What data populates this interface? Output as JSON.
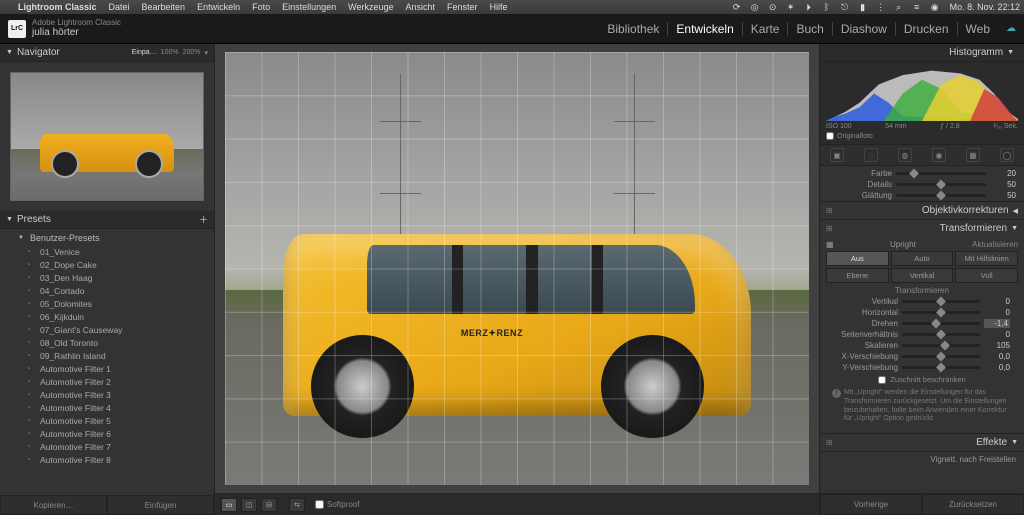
{
  "mac_menubar": {
    "app": "Lightroom Classic",
    "items": [
      "Datei",
      "Bearbeiten",
      "Entwickeln",
      "Foto",
      "Einstellungen",
      "Werkzeuge",
      "Ansicht",
      "Fenster",
      "Hilfe"
    ],
    "clock": "Mo. 8. Nov.  22:12"
  },
  "app_header": {
    "product": "Adobe Lightroom Classic",
    "catalog": "julia hörter",
    "modules": [
      "Bibliothek",
      "Entwickeln",
      "Karte",
      "Buch",
      "Diashow",
      "Drucken",
      "Web"
    ],
    "active_module": "Entwickeln"
  },
  "navigator": {
    "title": "Navigator",
    "zoom": [
      "Einpa…",
      "100%",
      "200%"
    ],
    "zoom_active": "Einpa…"
  },
  "presets": {
    "title": "Presets",
    "group": "Benutzer-Presets",
    "items": [
      "01_Venice",
      "02_Dope Cake",
      "03_Den Haag",
      "04_Cortado",
      "05_Dolomites",
      "06_Kijkduin",
      "07_Giant's Causeway",
      "08_Old Toronto",
      "09_Rathlin Island",
      "Automotive Filter 1",
      "Automotive Filter 2",
      "Automotive Filter 3",
      "Automotive Filter 4",
      "Automotive Filter 5",
      "Automotive Filter 6",
      "Automotive Filter 7",
      "Automotive Filter 8"
    ]
  },
  "left_bottom": {
    "copy": "Kopieren…",
    "paste": "Einfügen"
  },
  "toolbar": {
    "softproof": "Softproof"
  },
  "histogram": {
    "title": "Histogramm",
    "iso": "ISO 100",
    "focal": "54 mm",
    "aperture": "ƒ / 2,8",
    "shutter": "¹⁄₁₀ Sek.",
    "original": "Originalfoto"
  },
  "noise": {
    "farbe": {
      "label": "Farbe",
      "value": "20"
    },
    "details": {
      "label": "Details",
      "value": "50"
    },
    "glaettung": {
      "label": "Glättung",
      "value": "50"
    }
  },
  "lens": {
    "title": "Objektivkorrekturen"
  },
  "transform": {
    "title": "Transformieren",
    "upright_label": "Upright",
    "update": "Aktualisieren",
    "buttons": [
      "Aus",
      "Auto",
      "Mit Hilfslinien",
      "Ebene",
      "Vertikal",
      "Voll"
    ],
    "selected": "Aus",
    "sub": "Transformieren",
    "sliders": [
      {
        "label": "Vertikal",
        "value": "0",
        "pos": 50
      },
      {
        "label": "Horizontal",
        "value": "0",
        "pos": 50
      },
      {
        "label": "Drehen",
        "value": "-1,4",
        "pos": 43,
        "hl": true
      },
      {
        "label": "Seitenverhältnis",
        "value": "0",
        "pos": 50
      },
      {
        "label": "Skalieren",
        "value": "105",
        "pos": 55
      },
      {
        "label": "X-Verschiebung",
        "value": "0,0",
        "pos": 50
      },
      {
        "label": "Y-Verschiebung",
        "value": "0,0",
        "pos": 50
      }
    ],
    "constrain": "Zuschnitt beschränken",
    "info": "Mit „Upright“ werden die Einstellungen für das Transformieren zurückgesetzt. Um die Einstellungen beizubehalten, halte beim Anwenden einer Korrektur für „Upright“ Option gedrückt."
  },
  "effects": {
    "title": "Effekte",
    "vignette": "Vignett. nach Freistellen"
  },
  "right_bottom": {
    "prev": "Vorherige",
    "reset": "Zurücksetzen"
  },
  "car_brand": "MERZ✦RENZ"
}
